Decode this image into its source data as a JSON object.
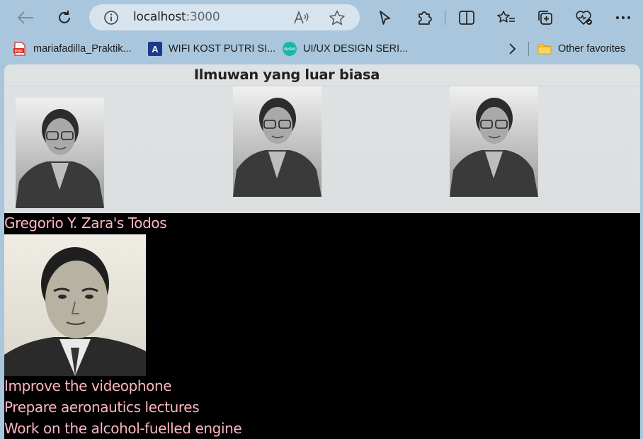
{
  "browser": {
    "url_host": "localhost",
    "url_port": ":3000"
  },
  "bookmarks": [
    {
      "label": "mariafadilla_Praktik...",
      "icon": "pdf-icon"
    },
    {
      "label": "WIFI KOST PUTRI SI...",
      "icon": "letter-a-icon"
    },
    {
      "label": "UI/UX DESIGN SERI...",
      "icon": "mysk-icon"
    }
  ],
  "other_favorites": "Other favorites",
  "page": {
    "title": "Ilmuwan yang luar biasa",
    "todos_heading": "Gregorio Y. Zara's Todos",
    "todos": [
      "Improve the videophone",
      "Prepare aeronautics lectures",
      "Work on the alcohol-fuelled engine"
    ]
  },
  "colors": {
    "chrome": "#a9c6dc",
    "address_bar": "#d6e4ef",
    "todo_text": "#ffb6c1",
    "page_bg": "#000000"
  }
}
